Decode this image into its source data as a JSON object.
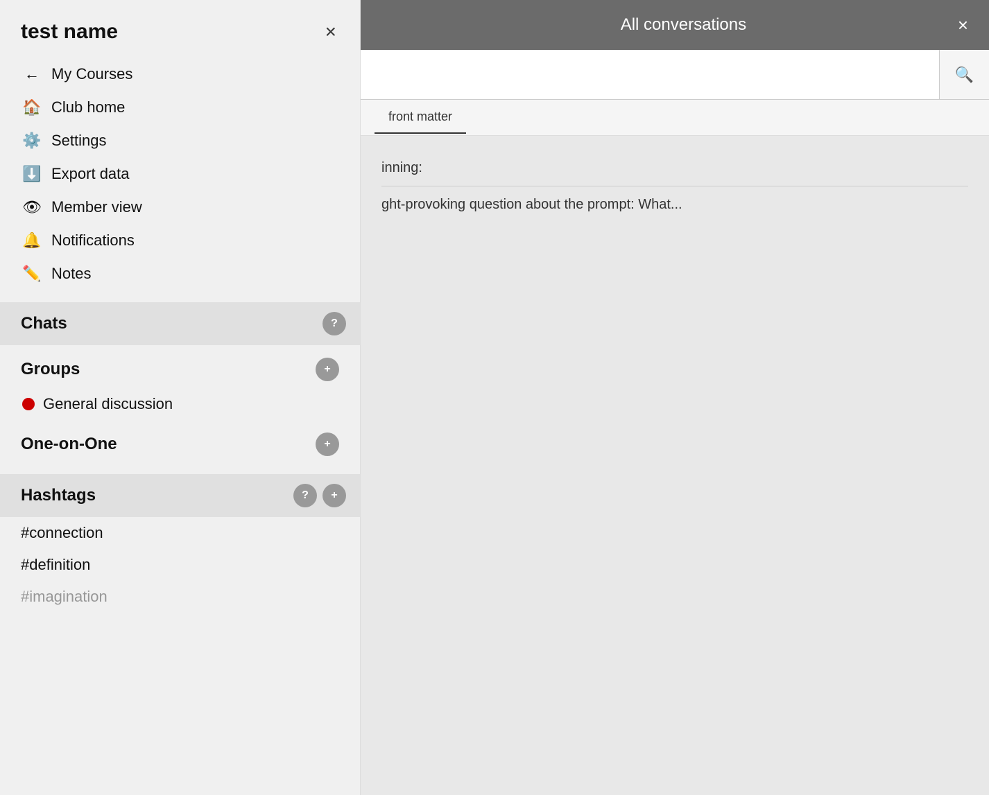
{
  "sidebar": {
    "title": "test name",
    "close_label": "×",
    "nav_items": [
      {
        "id": "my-courses",
        "icon": "←",
        "label": "My Courses"
      },
      {
        "id": "club-home",
        "icon": "⌂",
        "label": "Club home"
      },
      {
        "id": "settings",
        "icon": "⚙",
        "label": "Settings"
      },
      {
        "id": "export-data",
        "icon": "⬇",
        "label": "Export data"
      },
      {
        "id": "member-view",
        "icon": "◎",
        "label": "Member view"
      },
      {
        "id": "notifications",
        "icon": "▭",
        "label": "Notifications"
      },
      {
        "id": "notes",
        "icon": "✎",
        "label": "Notes"
      }
    ],
    "chats_section": {
      "title": "Chats",
      "help_icon": "?",
      "groups": {
        "title": "Groups",
        "add_icon": "+",
        "items": [
          {
            "id": "general-discussion",
            "label": "General discussion",
            "has_notification": true
          }
        ]
      },
      "one_on_one": {
        "title": "One-on-One",
        "add_icon": "+"
      },
      "hashtags": {
        "title": "Hashtags",
        "help_icon": "?",
        "add_icon": "+",
        "items": [
          {
            "id": "connection",
            "label": "#connection"
          },
          {
            "id": "definition",
            "label": "#definition"
          },
          {
            "id": "imagination",
            "label": "#imagination"
          }
        ]
      }
    }
  },
  "main": {
    "header": {
      "title": "All conversations",
      "close_label": "×"
    },
    "search": {
      "placeholder": "",
      "search_icon": "🔍"
    },
    "tab": {
      "label": "front matter"
    },
    "content": {
      "line1": "inning:",
      "line2": "ght-provoking question about the prompt: What..."
    }
  }
}
